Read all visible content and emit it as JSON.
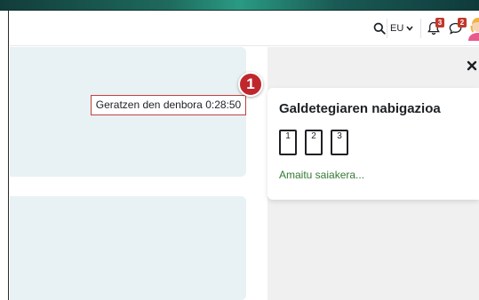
{
  "navbar": {
    "language": "EU",
    "notifications_count": "3",
    "messages_count": "2",
    "icons": [
      "search-icon",
      "chevron-down-icon",
      "bell-icon",
      "chat-icon",
      "avatar"
    ]
  },
  "timer": {
    "text": "Geratzen den denbora 0:28:50"
  },
  "callout": {
    "number": "1",
    "color": "#c0272d"
  },
  "drawer": {
    "close_icon": "close-icon",
    "title": "Galdetegiaren nabigazioa",
    "questions": [
      "1",
      "2",
      "3"
    ],
    "finish_link": "Amaitu saiakera..."
  },
  "colors": {
    "accent_green": "#357a32",
    "card_background": "#e8f1f3",
    "badge_red": "#c0392b"
  }
}
